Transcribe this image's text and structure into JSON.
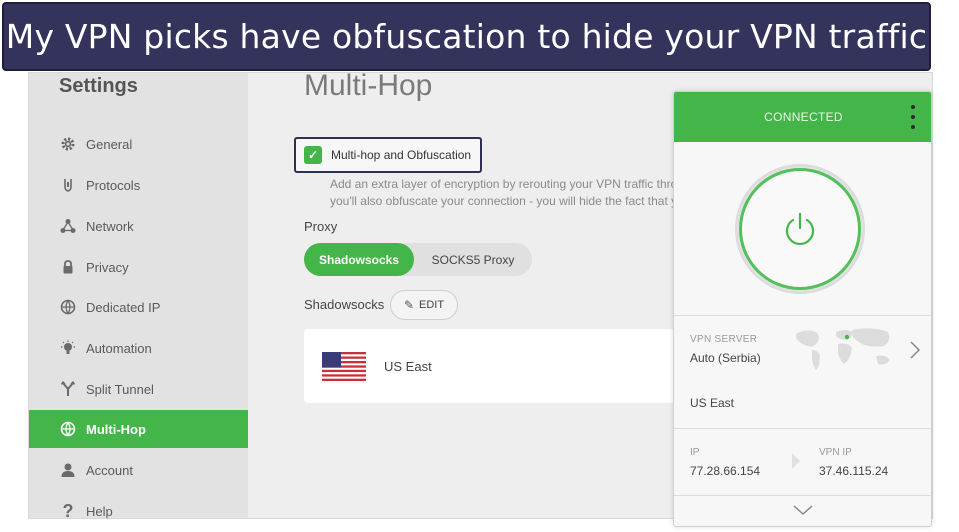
{
  "banner": {
    "text": "My VPN picks have obfuscation to hide your VPN traffic"
  },
  "sidebar": {
    "title": "Settings",
    "items": [
      {
        "label": "General",
        "icon": "gear-icon"
      },
      {
        "label": "Protocols",
        "icon": "protocols-icon"
      },
      {
        "label": "Network",
        "icon": "network-icon"
      },
      {
        "label": "Privacy",
        "icon": "lock-icon"
      },
      {
        "label": "Dedicated IP",
        "icon": "dedicated-ip-icon"
      },
      {
        "label": "Automation",
        "icon": "automation-icon"
      },
      {
        "label": "Split Tunnel",
        "icon": "split-tunnel-icon"
      },
      {
        "label": "Multi-Hop",
        "icon": "globe-icon",
        "active": true
      },
      {
        "label": "Account",
        "icon": "user-icon"
      },
      {
        "label": "Help",
        "icon": "help-icon"
      }
    ]
  },
  "main": {
    "title": "Multi-Hop",
    "multihop": {
      "label": "Multi-hop and Obfuscation",
      "checked": true,
      "desc_line1": "Add an extra layer of encryption by rerouting your VPN traffic thro",
      "desc_line2": "you'll also obfuscate your connection - you will hide the fact that y"
    },
    "proxy": {
      "label": "Proxy",
      "options": [
        "Shadowsocks",
        "SOCKS5 Proxy"
      ],
      "selected": "Shadowsocks"
    },
    "shadowsocks": {
      "label": "Shadowsocks",
      "edit_label": "EDIT"
    },
    "server": {
      "name": "US East",
      "flag": "us-flag-icon"
    }
  },
  "vpn_panel": {
    "status": "CONNECTED",
    "vpn_server_label": "VPN SERVER",
    "vpn_server_value": "Auto (Serbia)",
    "via_server": "US East",
    "ip_label": "IP",
    "ip_value": "77.28.66.154",
    "vpn_ip_label": "VPN IP",
    "vpn_ip_value": "37.46.115.24"
  },
  "colors": {
    "accent_green": "#44b649",
    "banner_bg": "#33335c",
    "sidebar_bg": "#e2e2e2"
  }
}
